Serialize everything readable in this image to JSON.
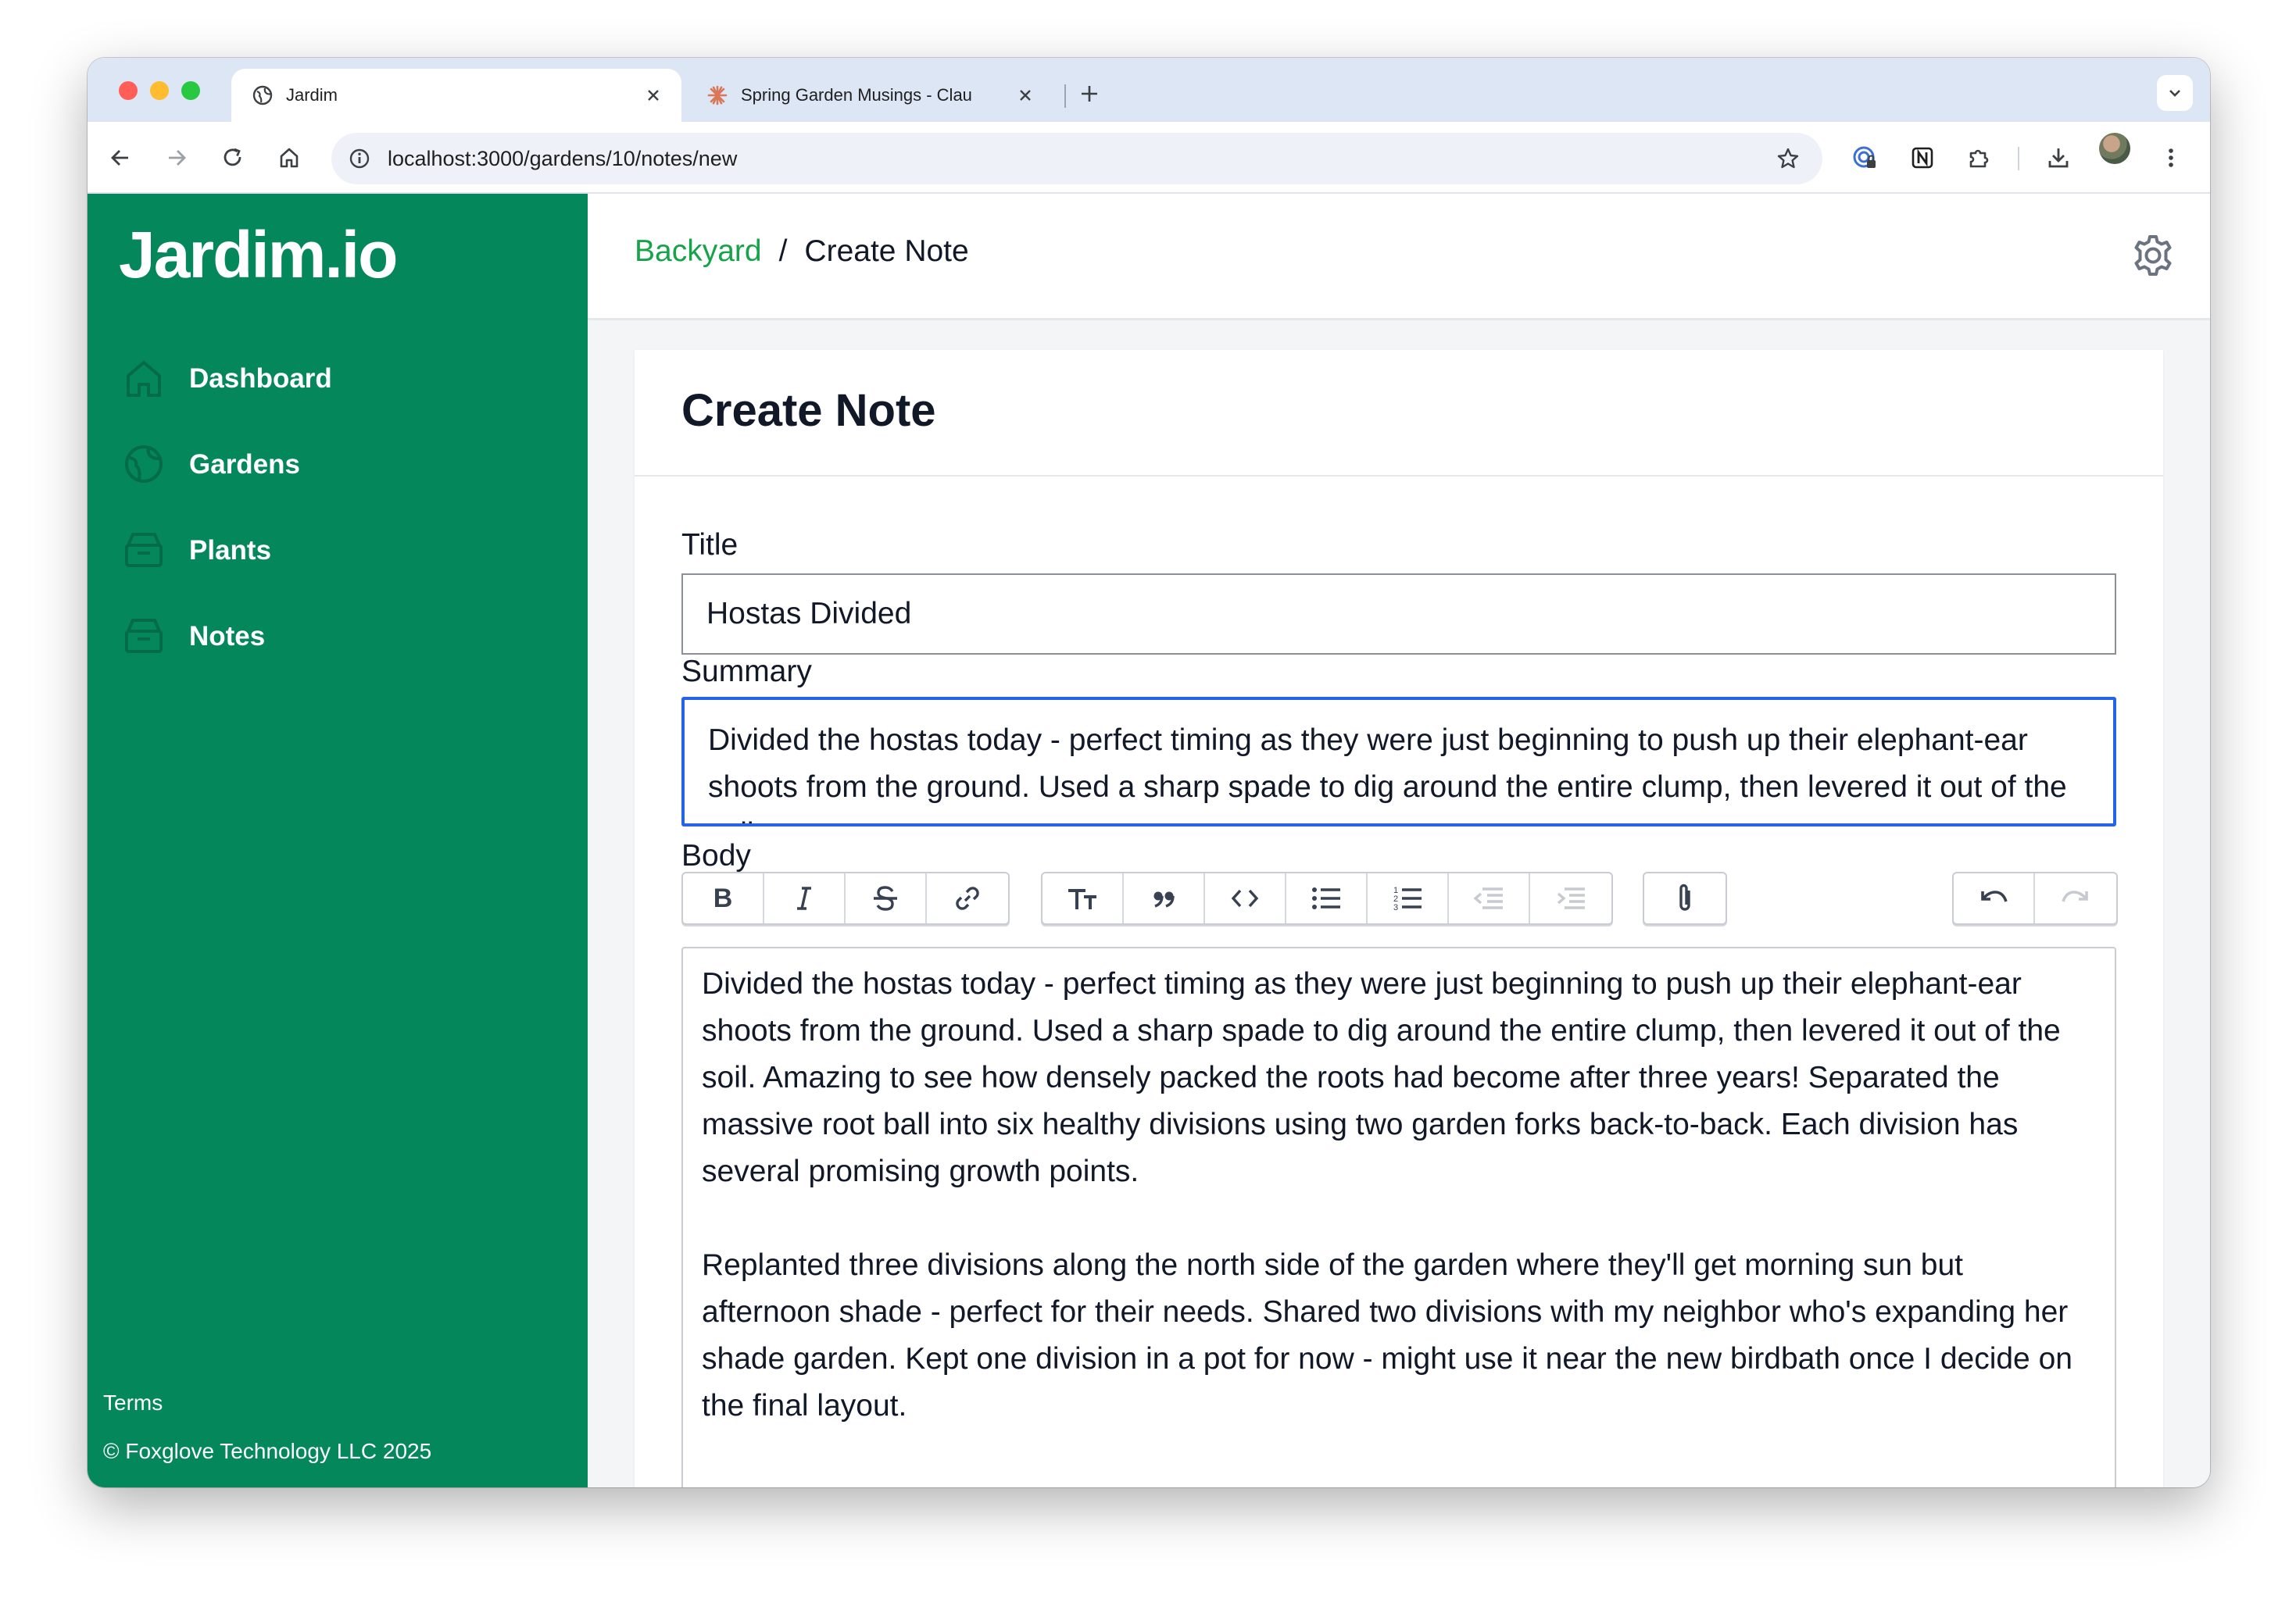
{
  "browser": {
    "tabs": [
      {
        "title": "Jardim",
        "active": true
      },
      {
        "title": "Spring Garden Musings - Clau",
        "active": false
      }
    ],
    "url": "localhost:3000/gardens/10/notes/new"
  },
  "sidebar": {
    "brand": "Jardim.io",
    "items": [
      {
        "label": "Dashboard",
        "icon": "home-icon"
      },
      {
        "label": "Gardens",
        "icon": "globe-icon"
      },
      {
        "label": "Plants",
        "icon": "box-icon"
      },
      {
        "label": "Notes",
        "icon": "box-icon"
      }
    ],
    "terms": "Terms",
    "copyright": "© Foxglove Technology LLC 2025"
  },
  "header": {
    "breadcrumb_parent": "Backyard",
    "breadcrumb_sep": "/",
    "breadcrumb_current": "Create Note"
  },
  "form": {
    "heading": "Create Note",
    "title_label": "Title",
    "title_value": "Hostas Divided",
    "summary_label": "Summary",
    "summary_value": "Divided the hostas today - perfect timing as they were just beginning to push up their elephant-ear shoots from the ground. Used a sharp spade to dig around the entire clump, then levered it out of the soil.",
    "body_label": "Body",
    "body_paragraphs": [
      "Divided the hostas today - perfect timing as they were just beginning to push up their elephant-ear shoots from the ground. Used a sharp spade to dig around the entire clump, then levered it out of the soil. Amazing to see how densely packed the roots had become after three years! Separated the massive root ball into six healthy divisions using two garden forks back-to-back. Each division has several promising growth points.",
      "Replanted three divisions along the north side of the garden where they'll get morning sun but afternoon shade - perfect for their needs. Shared two divisions with my neighbor who's expanding her shade garden. Kept one division in a pot for now - might use it near the new birdbath once I decide on the final layout."
    ]
  },
  "colors": {
    "sidebar": "#04875a",
    "link": "#16a34a",
    "focus": "#2563eb"
  }
}
